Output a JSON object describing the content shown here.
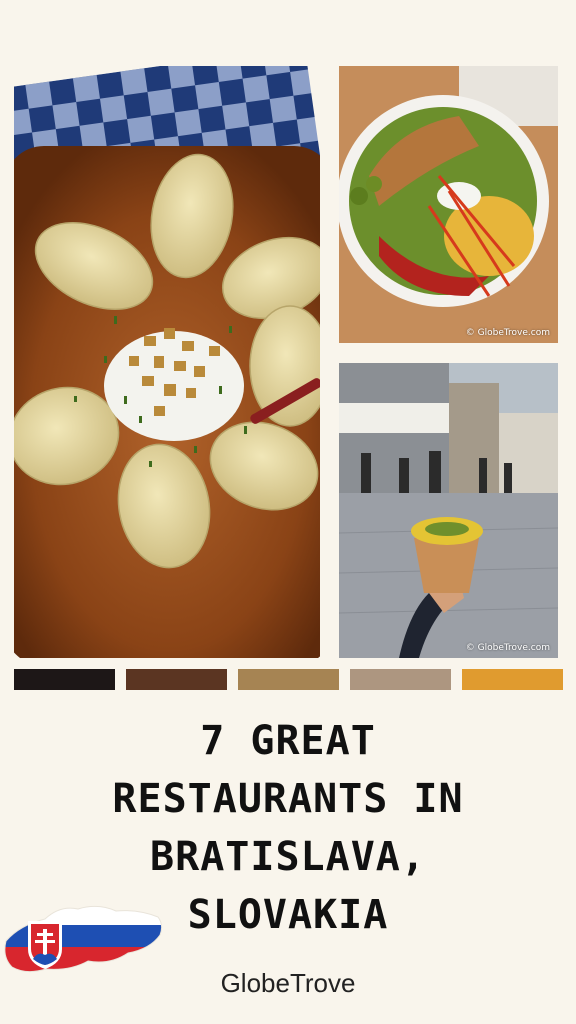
{
  "photos": [
    {
      "name": "dumplings",
      "watermark": ""
    },
    {
      "name": "bowl",
      "watermark": "© GlobeTrove.com"
    },
    {
      "name": "street",
      "watermark": "© GlobeTrove.com"
    }
  ],
  "palette": [
    "#1d1717",
    "#5b3522",
    "#a68453",
    "#ad9680",
    "#e09b2f"
  ],
  "title": {
    "line1": "7 GREAT",
    "line2": "RESTAURANTS IN",
    "line3": "BRATISLAVA,",
    "line4": "SLOVAKIA"
  },
  "brand": "GlobeTrove",
  "flag_colors": {
    "white": "#ffffff",
    "blue": "#1e4fb3",
    "red": "#d8262e"
  }
}
